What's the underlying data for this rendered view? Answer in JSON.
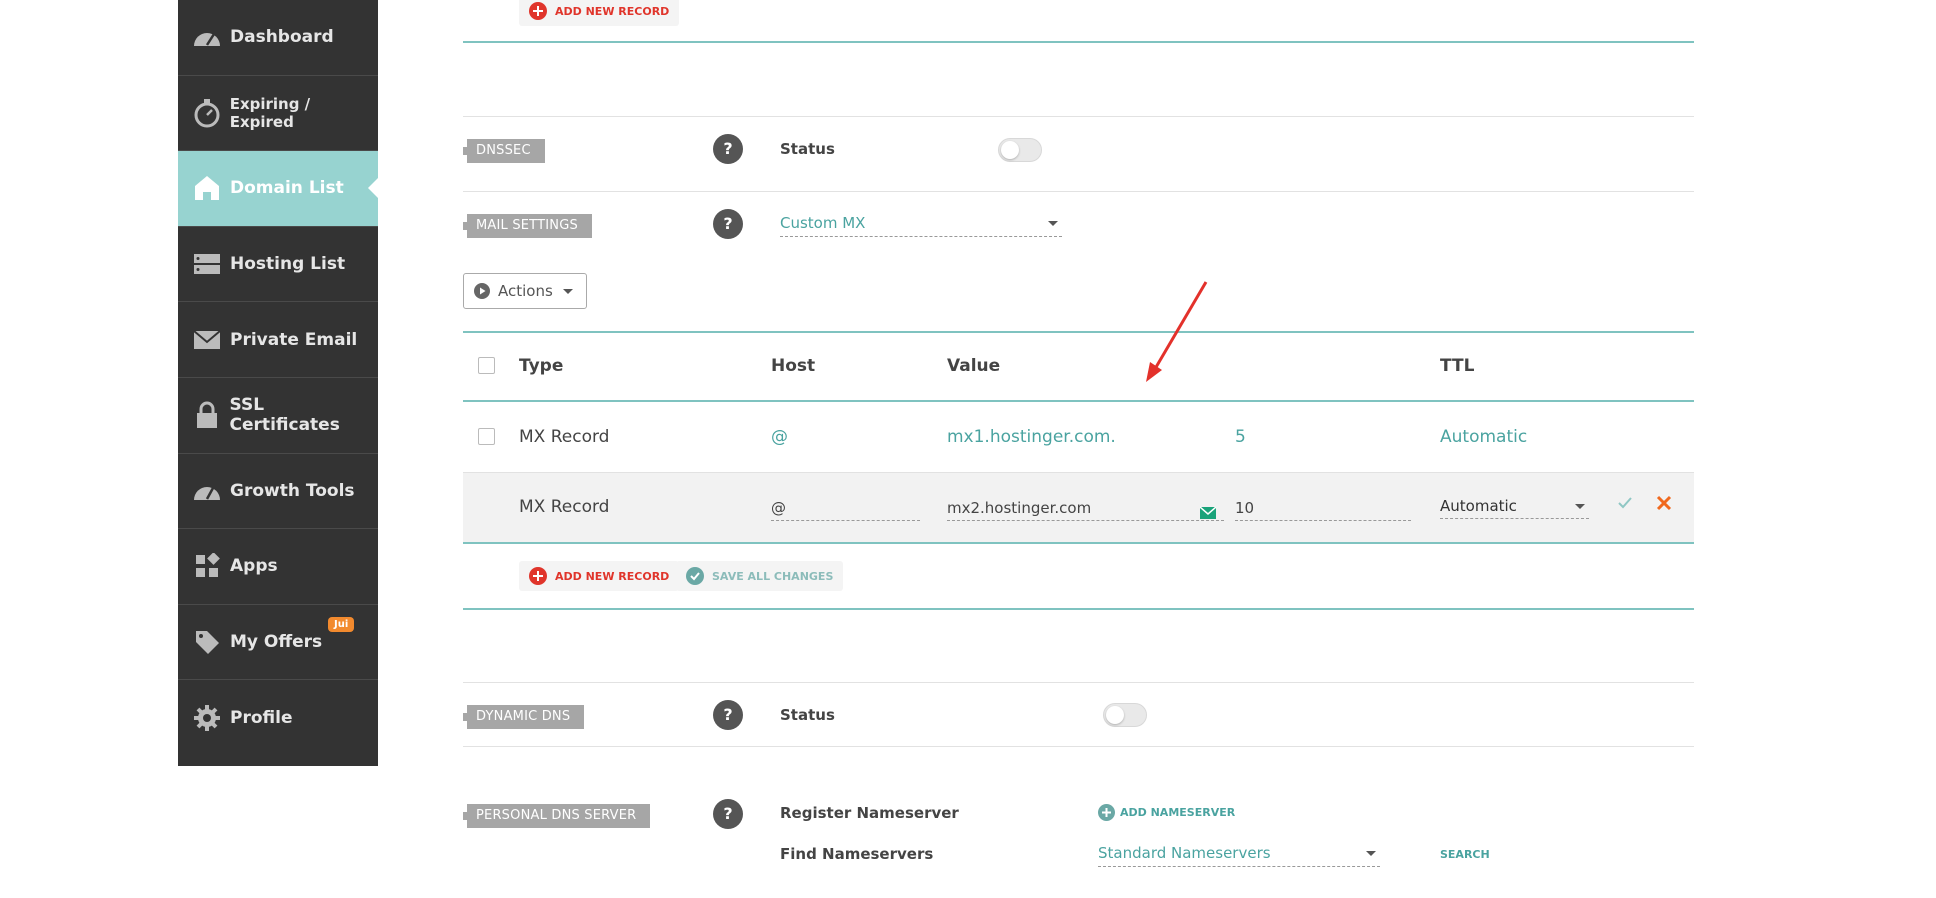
{
  "sidebar": {
    "items": [
      {
        "label": "Dashboard",
        "icon": "dashboard-gauge-icon"
      },
      {
        "label": "Expiring / Expired",
        "icon": "stopwatch-icon"
      },
      {
        "label": "Domain List",
        "icon": "home-icon",
        "active": true
      },
      {
        "label": "Hosting List",
        "icon": "server-icon"
      },
      {
        "label": "Private Email",
        "icon": "envelope-icon"
      },
      {
        "label": "SSL Certificates",
        "icon": "lock-icon"
      },
      {
        "label": "Growth Tools",
        "icon": "gauge-icon"
      },
      {
        "label": "Apps",
        "icon": "apps-grid-icon"
      },
      {
        "label": "My Offers",
        "icon": "tag-icon",
        "badge": "Jui"
      },
      {
        "label": "Profile",
        "icon": "gear-icon"
      }
    ]
  },
  "top_add_record": "ADD NEW RECORD",
  "dnssec": {
    "tag": "DNSSEC",
    "status_label": "Status",
    "enabled": false
  },
  "mail_settings": {
    "tag": "MAIL SETTINGS",
    "selected": "Custom MX"
  },
  "actions_button": "Actions",
  "table": {
    "headers": {
      "type": "Type",
      "host": "Host",
      "value": "Value",
      "ttl": "TTL"
    },
    "rows": [
      {
        "type": "MX Record",
        "host": "@",
        "value": "mx1.hostinger.com.",
        "priority": "5",
        "ttl": "Automatic"
      }
    ],
    "edit_row": {
      "type": "MX Record",
      "host": "@",
      "value": "mx2.hostinger.com",
      "priority": "10",
      "ttl": "Automatic"
    }
  },
  "add_new_record": "ADD NEW RECORD",
  "save_all_changes": "SAVE ALL CHANGES",
  "dynamic_dns": {
    "tag": "DYNAMIC DNS",
    "status_label": "Status",
    "enabled": false
  },
  "personal_dns": {
    "tag": "PERSONAL DNS SERVER",
    "register_label": "Register Nameserver",
    "add_nameserver": "ADD NAMESERVER",
    "find_label": "Find Nameservers",
    "find_selected": "Standard Nameservers",
    "search": "SEARCH"
  },
  "colors": {
    "accent": "#4aa3a0",
    "sidebar_bg": "#333333",
    "sidebar_active": "#97d3d0",
    "danger": "#e0352b",
    "badge": "#f28a2e"
  }
}
